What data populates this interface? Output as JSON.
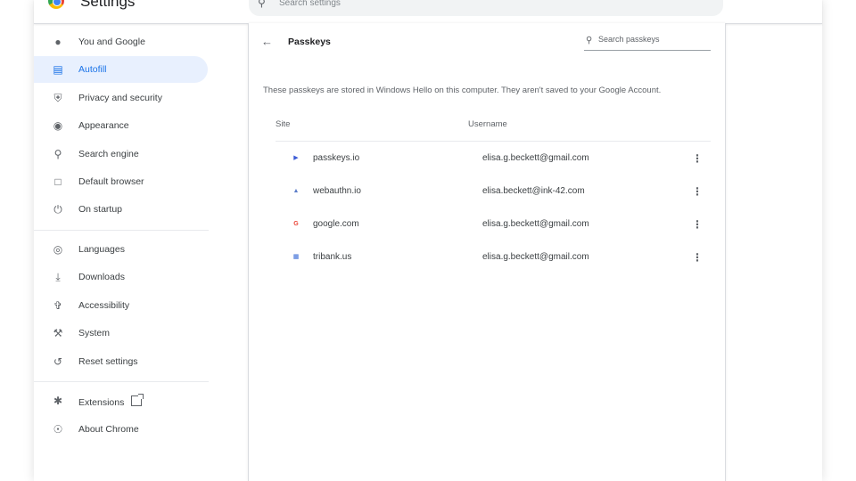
{
  "app": {
    "title": "Settings",
    "search_placeholder": "Search settings"
  },
  "sidebar": {
    "items": [
      {
        "label": "You and Google",
        "icon": "person-icon"
      },
      {
        "label": "Autofill",
        "icon": "clipboard-icon",
        "active": true
      },
      {
        "label": "Privacy and security",
        "icon": "shield-icon"
      },
      {
        "label": "Appearance",
        "icon": "palette-icon"
      },
      {
        "label": "Search engine",
        "icon": "search-icon"
      },
      {
        "label": "Default browser",
        "icon": "browser-icon"
      },
      {
        "label": "On startup",
        "icon": "power-icon"
      },
      {
        "label": "Languages",
        "icon": "globe-icon"
      },
      {
        "label": "Downloads",
        "icon": "download-icon"
      },
      {
        "label": "Accessibility",
        "icon": "accessibility-icon"
      },
      {
        "label": "System",
        "icon": "wrench-icon"
      },
      {
        "label": "Reset settings",
        "icon": "history-icon"
      },
      {
        "label": "Extensions",
        "icon": "puzzle-icon"
      },
      {
        "label": "About Chrome",
        "icon": "chrome-icon"
      }
    ]
  },
  "passkeys": {
    "title": "Passkeys",
    "search_placeholder": "Search passkeys",
    "description": "These passkeys are stored in Windows Hello on this computer. They aren't saved to your Google Account.",
    "columns": {
      "site": "Site",
      "username": "Username"
    },
    "rows": [
      {
        "site": "passkeys.io",
        "username": "elisa.g.beckett@gmail.com",
        "favicon_color": "#3c5bd6"
      },
      {
        "site": "webauthn.io",
        "username": "elisa.beckett@ink-42.com",
        "favicon_color": "#5b7dc9"
      },
      {
        "site": "google.com",
        "username": "elisa.g.beckett@gmail.com",
        "favicon_color": "#ea4335"
      },
      {
        "site": "tribank.us",
        "username": "elisa.g.beckett@gmail.com",
        "favicon_color": "#3367d6"
      }
    ]
  },
  "colors": {
    "accent": "#1a73e8",
    "active_bg": "#e8f0fe"
  }
}
